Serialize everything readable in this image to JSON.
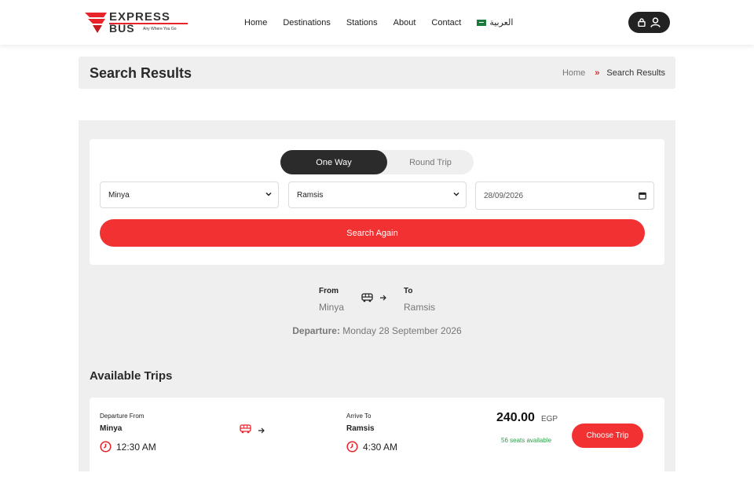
{
  "brand": {
    "name_top": "EXPRESS",
    "name_bottom": "BUS",
    "tagline": "Any Where You Go",
    "accent": "#e8232a"
  },
  "nav": {
    "items": [
      "Home",
      "Destinations",
      "Stations",
      "About",
      "Contact"
    ],
    "language": "العربية"
  },
  "header_icons": [
    "lock-icon",
    "user-icon"
  ],
  "page": {
    "title": "Search Results",
    "breadcrumb_home": "Home",
    "breadcrumb_sep": "»",
    "breadcrumb_current": "Search Results"
  },
  "search": {
    "trip_type_active": "One Way",
    "trip_type_inactive": "Round Trip",
    "from_value": "Minya",
    "to_value": "Ramsis",
    "date_value": "28/09/2026",
    "button_label": "Search Again",
    "button_color": "#f23232"
  },
  "route": {
    "from_label": "From",
    "from_value": "Minya",
    "to_label": "To",
    "to_value": "Ramsis",
    "departure_label": "Departure:",
    "departure_value": "Monday 28 September 2026"
  },
  "results": {
    "title": "Available Trips",
    "trips": [
      {
        "departure_label": "Departure From",
        "departure_city": "Minya",
        "departure_time": "12:30 AM",
        "arrive_label": "Arrive To",
        "arrive_city": "Ramsis",
        "arrive_time": "4:30 AM",
        "price": "240.00",
        "currency": "EGP",
        "seats": "56 seats available",
        "button_label": "Choose Trip"
      }
    ]
  }
}
